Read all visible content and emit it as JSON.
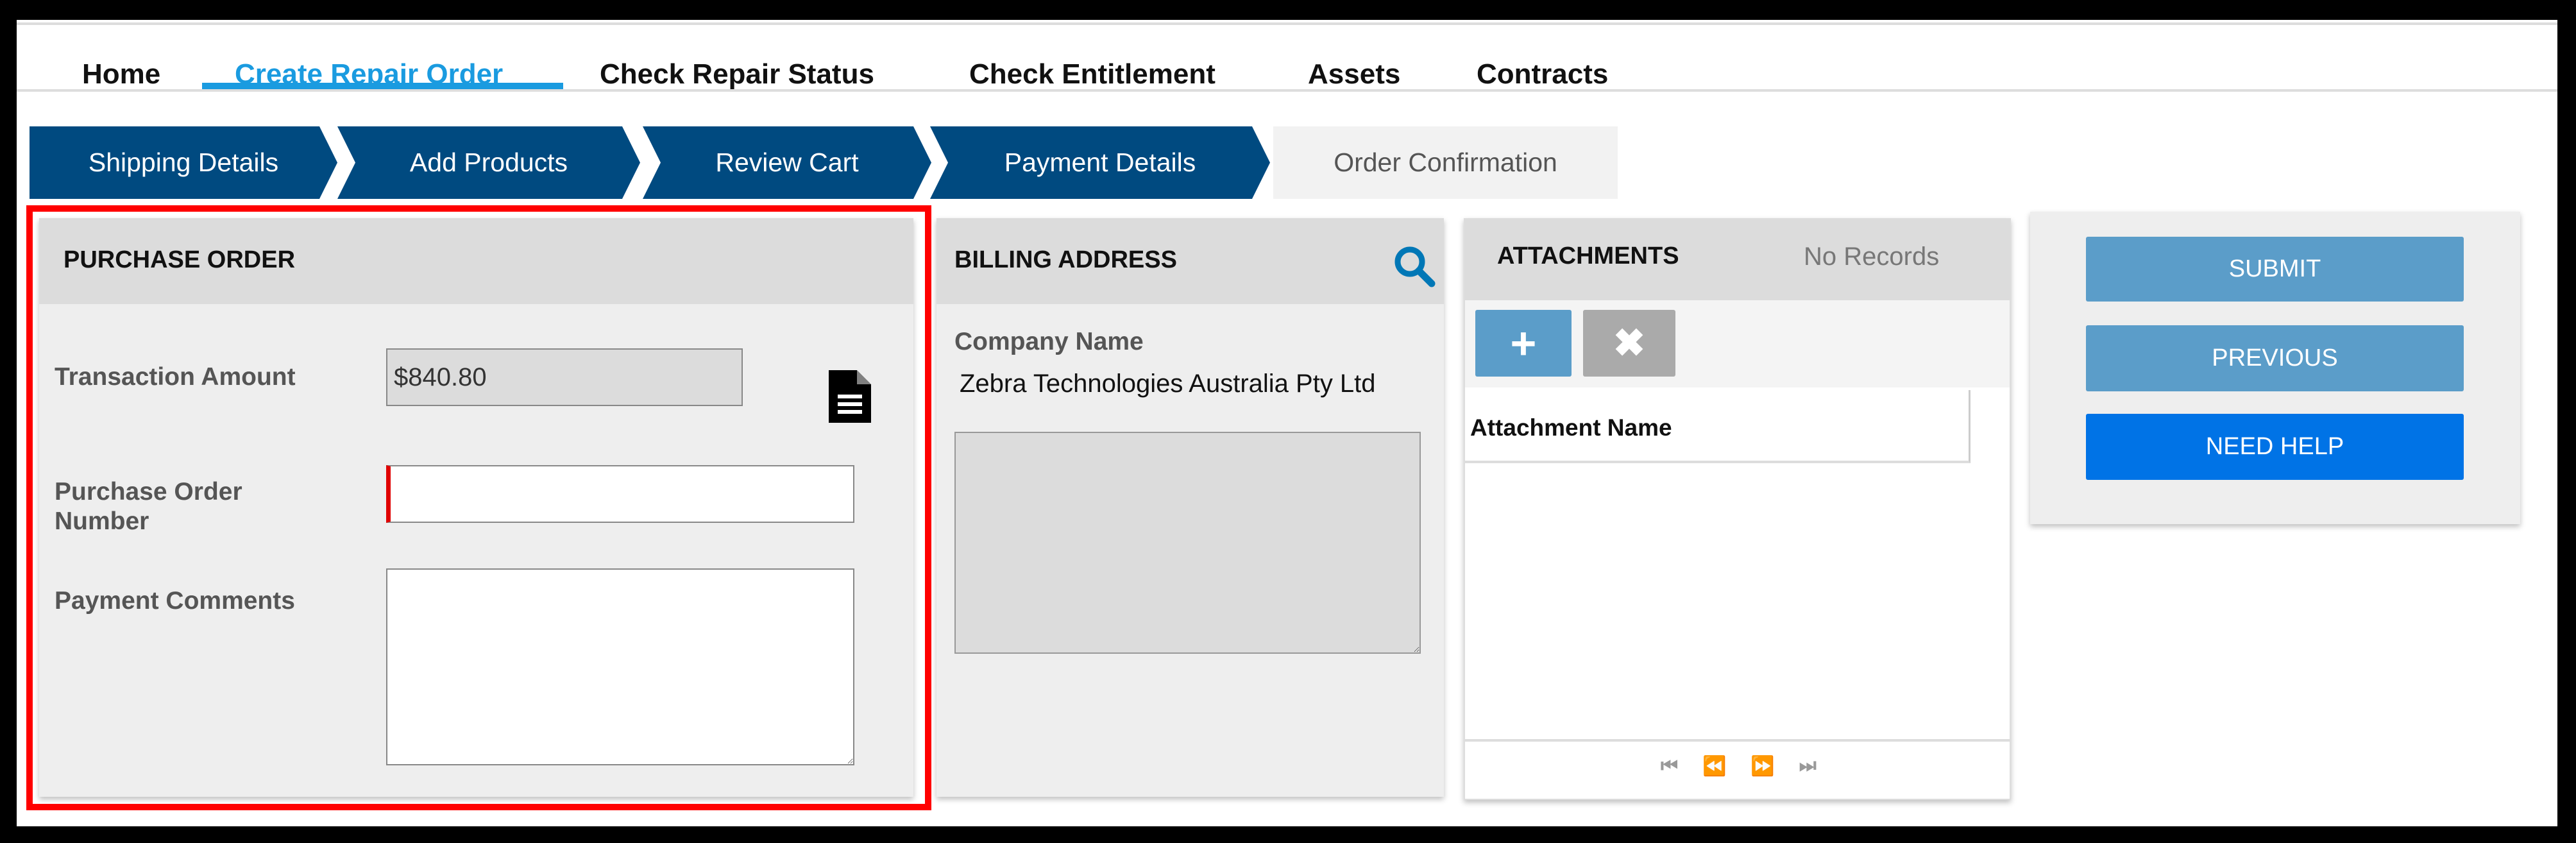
{
  "nav": {
    "tabs": [
      {
        "label": "Home"
      },
      {
        "label": "Create Repair Order",
        "active": true
      },
      {
        "label": "Check Repair Status"
      },
      {
        "label": "Check Entitlement"
      },
      {
        "label": "Assets"
      },
      {
        "label": "Contracts"
      }
    ]
  },
  "steps": [
    {
      "label": "Shipping Details",
      "state": "done"
    },
    {
      "label": "Add Products",
      "state": "done"
    },
    {
      "label": "Review Cart",
      "state": "done"
    },
    {
      "label": "Payment Details",
      "state": "current"
    },
    {
      "label": "Order Confirmation",
      "state": "todo"
    }
  ],
  "purchase_order": {
    "title": "PURCHASE ORDER",
    "transaction_amount_label": "Transaction Amount",
    "transaction_amount": "$840.80",
    "po_number_label": "Purchase Order Number",
    "po_number": "",
    "payment_comments_label": "Payment Comments",
    "payment_comments": "",
    "highlight_color": "#ff0000"
  },
  "billing": {
    "title": "BILLING ADDRESS",
    "company_name_label": "Company Name",
    "company_name": "Zebra Technologies Australia Pty Ltd",
    "address": ""
  },
  "attachments": {
    "title": "ATTACHMENTS",
    "status": "No Records",
    "column": "Attachment Name"
  },
  "actions": {
    "submit": "SUBMIT",
    "previous": "PREVIOUS",
    "need_help": "NEED HELP"
  },
  "colors": {
    "accent": "#1a9be0",
    "step": "#004a80",
    "button": "#5b9dc9",
    "help": "#0073e6"
  }
}
